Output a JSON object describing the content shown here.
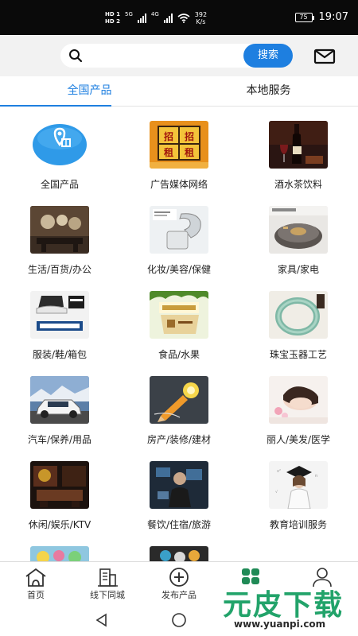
{
  "status_bar": {
    "hd1": "HD 1",
    "hd2": "HD 2",
    "net1": "5G",
    "net2": "4G",
    "speed_value": "392",
    "speed_unit": "K/s",
    "battery": "75",
    "time": "19:07"
  },
  "search": {
    "placeholder": "",
    "button_label": "搜索"
  },
  "tabs": [
    {
      "label": "全国产品",
      "active": true
    },
    {
      "label": "本地服务",
      "active": false
    }
  ],
  "categories": [
    {
      "label": "全国产品",
      "icon": "location-gift-icon",
      "overlay": ""
    },
    {
      "label": "广告媒体网络",
      "icon": "billboard-image",
      "overlay": "招租"
    },
    {
      "label": "酒水茶饮料",
      "icon": "wine-image",
      "overlay": ""
    },
    {
      "label": "生活/百货/办公",
      "icon": "interior-image",
      "overlay": ""
    },
    {
      "label": "化妆/美容/保健",
      "icon": "cosmetics-image",
      "overlay": ""
    },
    {
      "label": "家具/家电",
      "icon": "robot-vacuum-image",
      "overlay": ""
    },
    {
      "label": "服装/鞋/箱包",
      "icon": "shoes-image",
      "overlay": ""
    },
    {
      "label": "食品/水果",
      "icon": "food-box-image",
      "overlay": ""
    },
    {
      "label": "珠宝玉器工艺",
      "icon": "jade-bracelet-image",
      "overlay": ""
    },
    {
      "label": "汽车/保养/用品",
      "icon": "car-image",
      "overlay": ""
    },
    {
      "label": "房产/装修/建材",
      "icon": "lightbulb-pencil-image",
      "overlay": ""
    },
    {
      "label": "丽人/美发/医学",
      "icon": "spa-image",
      "overlay": ""
    },
    {
      "label": "休闲/娱乐/KTV",
      "icon": "ktv-image",
      "overlay": ""
    },
    {
      "label": "餐饮/住宿/旅游",
      "icon": "business-image",
      "overlay": ""
    },
    {
      "label": "教育培训服务",
      "icon": "graduate-image",
      "overlay": ""
    },
    {
      "label": "",
      "icon": "partial-image",
      "overlay": ""
    },
    {
      "label": "",
      "icon": "partial-image",
      "overlay": ""
    }
  ],
  "bottom_nav": [
    {
      "label": "首页",
      "icon": "home-icon"
    },
    {
      "label": "线下同城",
      "icon": "building-icon"
    },
    {
      "label": "发布产品",
      "icon": "add-circle-icon"
    },
    {
      "label": "",
      "icon": "grid-apps-icon"
    },
    {
      "label": "",
      "icon": "user-icon"
    }
  ],
  "watermark": {
    "main": "元皮下载",
    "url": "www.yuanpi.com"
  },
  "colors": {
    "accent": "#1e7fe0",
    "watermark_green": "#22a36a"
  }
}
